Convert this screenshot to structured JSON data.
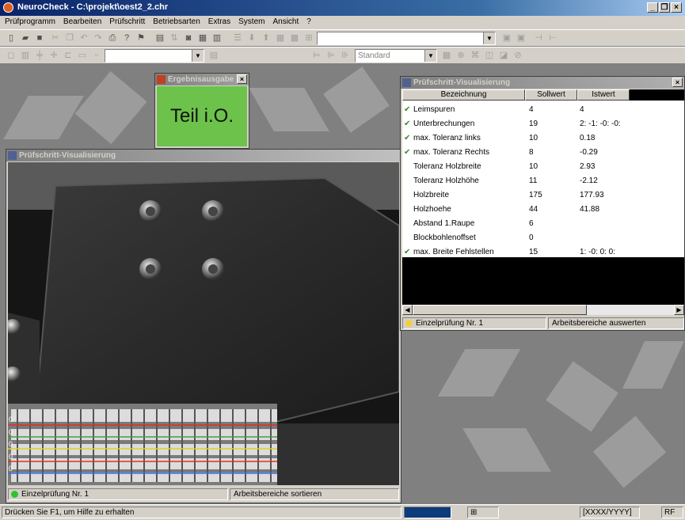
{
  "window": {
    "title": "NeuroCheck - C:\\projekt\\oest2_2.chr",
    "minimize": "_",
    "restore": "❐",
    "close": "×"
  },
  "menu": [
    "Prüfprogramm",
    "Bearbeiten",
    "Prüfschritt",
    "Betriebsarten",
    "Extras",
    "System",
    "Ansicht",
    "?"
  ],
  "toolbar2": {
    "combo_value": "Standard"
  },
  "result_window": {
    "title": "Ergebnisausgabe",
    "close": "×",
    "result_text": "Teil i.O.",
    "result_color": "#6cc24a"
  },
  "camera_window": {
    "title": "Prüfschritt-Visualisierung",
    "status_left": "Einzelprüfung Nr. 1",
    "status_right": "Arbeitsbereiche sortieren",
    "led_color": "#2ec32e",
    "line_labels": [
      "0",
      "0",
      "0",
      "0",
      "0"
    ]
  },
  "table_window": {
    "title": "Prüfschritt-Visualisierung",
    "close": "×",
    "columns": [
      "Bezeichnung",
      "Sollwert",
      "Istwert"
    ],
    "rows": [
      {
        "check": "✔",
        "name": "Leimspuren",
        "soll": "4",
        "ist": "4"
      },
      {
        "check": "✔",
        "name": "Unterbrechungen",
        "soll": "19",
        "ist": "2: -1: -0: -0:"
      },
      {
        "check": "✔",
        "name": "max. Toleranz links",
        "soll": "10",
        "ist": "0.18"
      },
      {
        "check": "✔",
        "name": "max. Toleranz Rechts",
        "soll": "8",
        "ist": "-0.29"
      },
      {
        "check": "",
        "name": "Toleranz Holzbreite",
        "soll": "10",
        "ist": "2.93"
      },
      {
        "check": "",
        "name": "Toleranz Holzhöhe",
        "soll": "11",
        "ist": "-2.12"
      },
      {
        "check": "",
        "name": "Holzbreite",
        "soll": "175",
        "ist": "177.93"
      },
      {
        "check": "",
        "name": "Holzhoehe",
        "soll": "44",
        "ist": "41.88"
      },
      {
        "check": "",
        "name": "Abstand 1.Raupe",
        "soll": "6",
        "ist": ""
      },
      {
        "check": "",
        "name": "Blockbohlenoffset",
        "soll": "0",
        "ist": ""
      },
      {
        "check": "✔",
        "name": "max. Breite Fehlstellen",
        "soll": "15",
        "ist": "1: -0: 0: 0:"
      }
    ],
    "status_left": "Einzelprüfung Nr. 1",
    "status_right": "Arbeitsbereiche auswerten",
    "led_color": "#f0d040"
  },
  "statusbar": {
    "hint": "Drücken Sie F1, um Hilfe zu erhalten",
    "indicator": "[XXXX/YYYY]",
    "mode": "RF"
  }
}
